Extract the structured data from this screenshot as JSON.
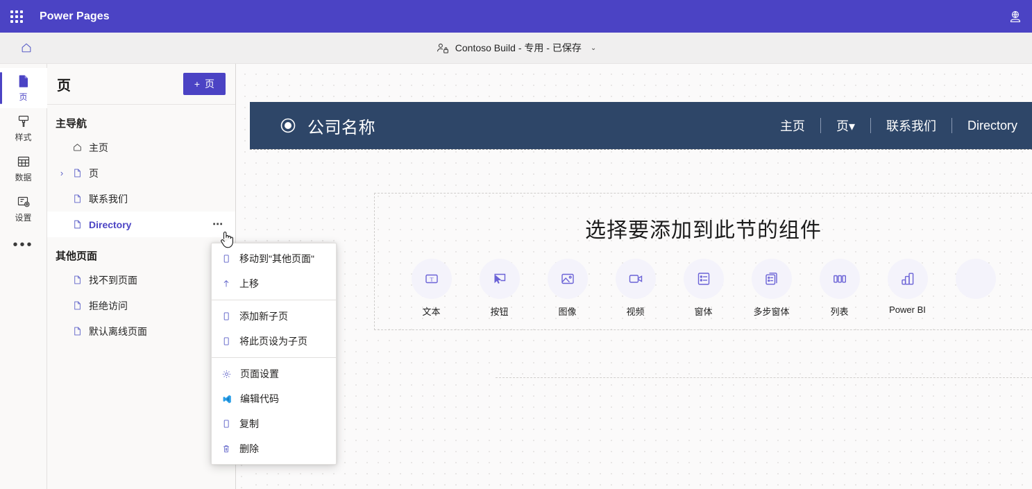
{
  "suite_bar": {
    "app_launcher_icon": "waffle-grid-icon",
    "title": "Power Pages",
    "right_icon": "globe-person-icon"
  },
  "command_bar": {
    "home_icon": "home-icon",
    "site_chip": {
      "icon": "people-lock-icon",
      "label": "Contoso Build - 专用 - 已保存",
      "chevron": "⌄"
    }
  },
  "rail": {
    "items": [
      {
        "icon": "page-file-icon",
        "label": "页",
        "active": true
      },
      {
        "icon": "paint-brush-icon",
        "label": "样式",
        "active": false
      },
      {
        "icon": "table-grid-icon",
        "label": "数据",
        "active": false
      },
      {
        "icon": "settings-gear-icon",
        "label": "设置",
        "active": false
      }
    ],
    "more_label": "•••"
  },
  "pages_panel": {
    "title": "页",
    "new_page_button": {
      "plus": "+",
      "label": "页"
    },
    "groups": [
      {
        "title": "主导航",
        "items": [
          {
            "label": "主页",
            "icon": "home-outline-icon",
            "expandable": false,
            "selected": false
          },
          {
            "label": "页",
            "icon": "file-icon",
            "expandable": true,
            "selected": false,
            "chevron": "›"
          },
          {
            "label": "联系我们",
            "icon": "file-icon",
            "expandable": false,
            "selected": false
          },
          {
            "label": "Directory",
            "icon": "file-icon",
            "expandable": false,
            "selected": true,
            "ellipsis": "⋯"
          }
        ]
      },
      {
        "title": "其他页面",
        "items": [
          {
            "label": "找不到页面",
            "icon": "file-icon",
            "expandable": false,
            "selected": false
          },
          {
            "label": "拒绝访问",
            "icon": "file-icon",
            "expandable": false,
            "selected": false
          },
          {
            "label": "默认离线页面",
            "icon": "file-icon",
            "expandable": false,
            "selected": false
          }
        ]
      }
    ]
  },
  "context_menu": {
    "items": [
      {
        "label": "移动到\"其他页面\"",
        "icon": "page-move-icon",
        "separator_after": false
      },
      {
        "label": "上移",
        "icon": "arrow-up-icon",
        "separator_after": true
      },
      {
        "label": "添加新子页",
        "icon": "page-add-icon",
        "separator_after": false
      },
      {
        "label": "将此页设为子页",
        "icon": "page-child-icon",
        "separator_after": true
      },
      {
        "label": "页面设置",
        "icon": "gear-icon",
        "separator_after": false
      },
      {
        "label": "编辑代码",
        "icon": "vscode-icon",
        "separator_after": false
      },
      {
        "label": "复制",
        "icon": "copy-icon",
        "separator_after": false
      },
      {
        "label": "删除",
        "icon": "trash-icon",
        "separator_after": false
      }
    ]
  },
  "canvas": {
    "site_header": {
      "logo_icon": "circle-target-icon",
      "brand_name": "公司名称",
      "background_color": "#2e4668",
      "nav_links": [
        {
          "label": "主页"
        },
        {
          "label": "页",
          "has_caret": true,
          "caret": "▾"
        },
        {
          "label": "联系我们"
        },
        {
          "label": "Directory"
        }
      ]
    },
    "section": {
      "title": "选择要添加到此节的组件",
      "components": [
        {
          "label": "文本",
          "icon": "text-box-icon"
        },
        {
          "label": "按钮",
          "icon": "button-cursor-icon"
        },
        {
          "label": "图像",
          "icon": "image-icon"
        },
        {
          "label": "视频",
          "icon": "video-camera-icon"
        },
        {
          "label": "窗体",
          "icon": "form-icon"
        },
        {
          "label": "多步窗体",
          "icon": "multistep-form-icon"
        },
        {
          "label": "列表",
          "icon": "list-columns-icon"
        },
        {
          "label": "Power BI",
          "icon": "power-bi-chart-icon"
        },
        {
          "label": "",
          "icon": "clipped-component-icon"
        }
      ]
    }
  },
  "colors": {
    "suite_bar": "#4b43c4",
    "accent_purple": "#4b43c4",
    "site_header_blue": "#2e4668",
    "panel_bg": "#faf9f8",
    "canvas_bg": "#fbfafa"
  }
}
